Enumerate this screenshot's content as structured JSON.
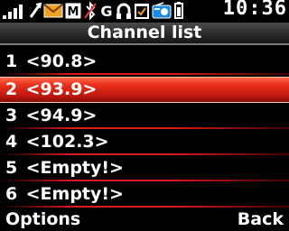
{
  "status": {
    "time": "10:36",
    "icons": [
      "signal-icon",
      "network-transfer-icon",
      "message-icon",
      "mms-icon",
      "bluetooth-off-icon",
      "gprs-icon",
      "headset-icon",
      "calendar-icon",
      "radio-icon"
    ]
  },
  "title": "Channel list",
  "channels": [
    {
      "num": "1",
      "label": "<90.8>",
      "selected": false
    },
    {
      "num": "2",
      "label": "<93.9>",
      "selected": true
    },
    {
      "num": "3",
      "label": "<94.9>",
      "selected": false
    },
    {
      "num": "4",
      "label": "<102.3>",
      "selected": false
    },
    {
      "num": "5",
      "label": "<Empty!>",
      "selected": false
    },
    {
      "num": "6",
      "label": "<Empty!>",
      "selected": false
    }
  ],
  "softkeys": {
    "left": "Options",
    "right": "Back"
  },
  "colors": {
    "selection": "#d02414",
    "divider": "#e01818",
    "background": "#000000"
  }
}
